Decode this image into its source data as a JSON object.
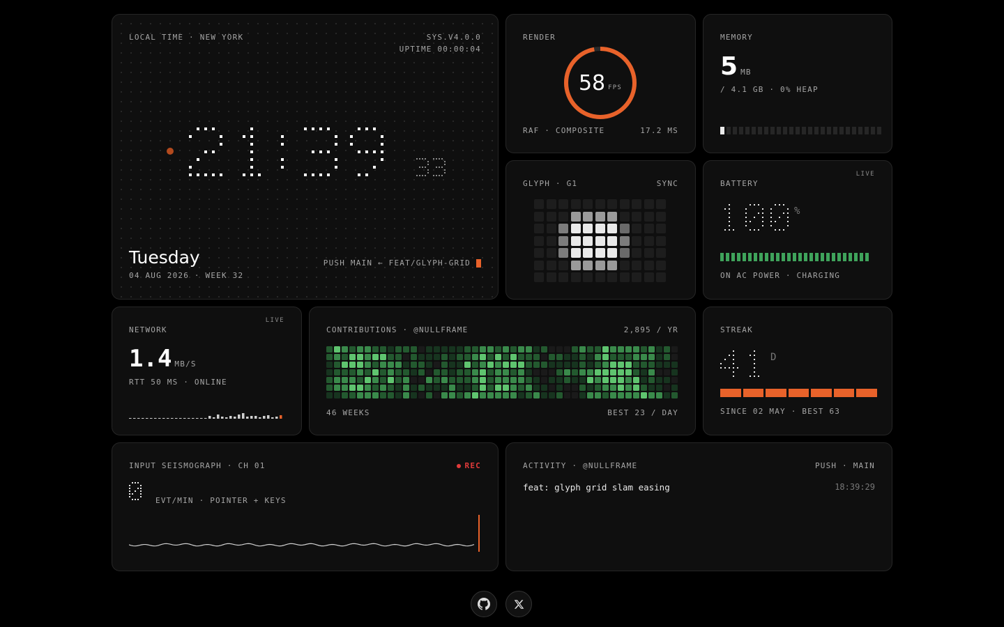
{
  "clock": {
    "label": "LOCAL TIME · NEW YORK",
    "version": "SYS.V4.0.0",
    "uptime": "UPTIME 00:00:04",
    "time": "21:39",
    "seconds": "33",
    "day": "Tuesday",
    "date": "04 AUG 2026 · WEEK 32",
    "commit": "PUSH MAIN ← FEAT/GLYPH-GRID"
  },
  "render": {
    "label": "RENDER",
    "fps": "58",
    "fps_unit": "FPS",
    "fps_fraction": 0.97,
    "footer_left": "RAF · COMPOSITE",
    "footer_right": "17.2 MS"
  },
  "memory": {
    "label": "MEMORY",
    "value": "5",
    "unit": "MB",
    "detail": "/ 4.1 GB · 0% HEAP",
    "segments_total": 26,
    "segments_filled": 1
  },
  "glyph": {
    "label": "GLYPH · G1",
    "status": "SYNC"
  },
  "battery": {
    "label": "BATTERY",
    "live": "LIVE",
    "value": "100",
    "unit": "%",
    "status": "ON AC POWER · CHARGING",
    "level": 1.0
  },
  "network": {
    "label": "NETWORK",
    "live": "LIVE",
    "value": "1.4",
    "unit": "MB/S",
    "detail": "RTT 50 MS · ONLINE"
  },
  "contributions": {
    "label": "CONTRIBUTIONS · @NULLFRAME",
    "total": "2,895 / YR",
    "weeks": "46 WEEKS",
    "best": "BEST 23 / DAY"
  },
  "streak": {
    "label": "STREAK",
    "value": "41",
    "unit": "D",
    "detail": "SINCE 02 MAY · BEST 63",
    "bars": 7
  },
  "seismo": {
    "label": "INPUT SEISMOGRAPH · CH 01",
    "rec": "REC",
    "value": "0",
    "detail": "EVT/MIN · POINTER + KEYS"
  },
  "activity": {
    "label": "ACTIVITY · @NULLFRAME",
    "branch": "PUSH · MAIN",
    "message": "feat: glyph grid slam easing",
    "time": "18:39:29"
  },
  "colors": {
    "accent": "#e8622a",
    "green": "#3fa35b",
    "red": "#e23b3b"
  },
  "icons": [
    "github-icon",
    "x-icon"
  ]
}
